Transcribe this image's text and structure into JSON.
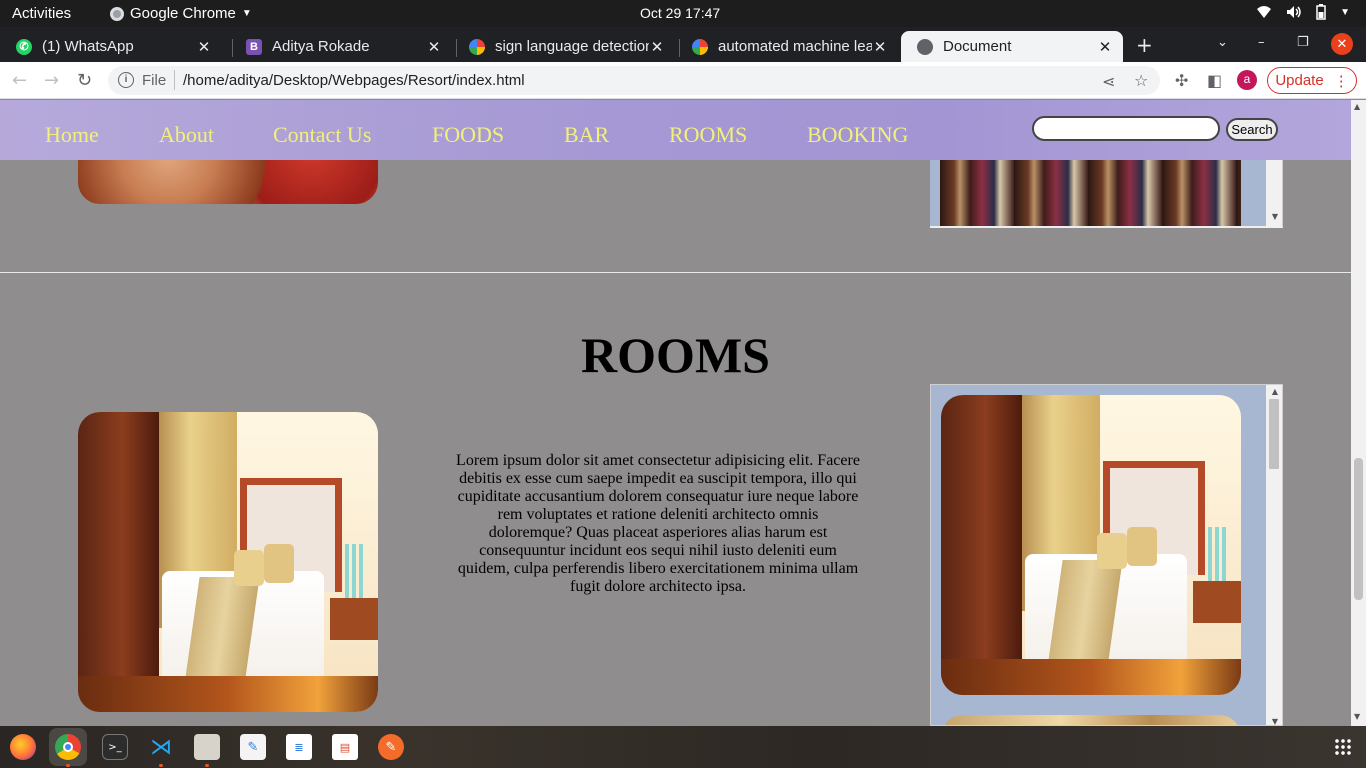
{
  "topbar": {
    "activities": "Activities",
    "app_name": "Google Chrome",
    "clock": "Oct 29  17:47"
  },
  "tabs": [
    {
      "title": "(1) WhatsApp",
      "icon": "whatsapp-icon",
      "color": "#25d366"
    },
    {
      "title": "Aditya Rokade",
      "icon": "bootstrap-icon",
      "color": "#7952b3",
      "letter": "B"
    },
    {
      "title": "sign language detection",
      "icon": "google-icon",
      "color": "#4285f4"
    },
    {
      "title": "automated machine learning",
      "icon": "google-icon",
      "color": "#4285f4"
    },
    {
      "title": "Document",
      "icon": "globe-icon",
      "color": "#5f6368",
      "active": true
    }
  ],
  "toolbar": {
    "scheme_label": "File",
    "url": "/home/aditya/Desktop/Webpages/Resort/index.html",
    "profile_letter": "a",
    "update_label": "Update"
  },
  "site": {
    "nav": [
      "Home",
      "About",
      "Contact Us",
      "FOODS",
      "BAR",
      "ROOMS",
      "BOOKING"
    ],
    "search_value": "",
    "search_button": "Search",
    "rooms_heading": "ROOMS",
    "rooms_text": "Lorem ipsum dolor sit amet consectetur adipisicing elit. Facere debitis ex esse cum saepe impedit ea suscipit tempora, illo qui cupiditate accusantium dolorem consequatur iure neque labore rem voluptates et ratione deleniti architecto omnis doloremque? Quas placeat asperiores alias harum est consequuntur incidunt eos sequi nihil iusto deleniti eum quidem, culpa perferendis libero exercitationem minima ullam fugit dolore architecto ipsa."
  },
  "colors": {
    "page_bg": "#8f8d8d",
    "nav_link": "#f1f17a",
    "nav_bg": "#a598d4",
    "gallery_bg": "#a7b7d2",
    "update_red": "#d93025"
  },
  "dock": [
    "firefox-icon",
    "chrome-icon",
    "terminal-icon",
    "vscode-icon",
    "files-icon",
    "text-editor-icon",
    "document-viewer-icon",
    "spreadsheet-icon",
    "inkscape-icon"
  ]
}
